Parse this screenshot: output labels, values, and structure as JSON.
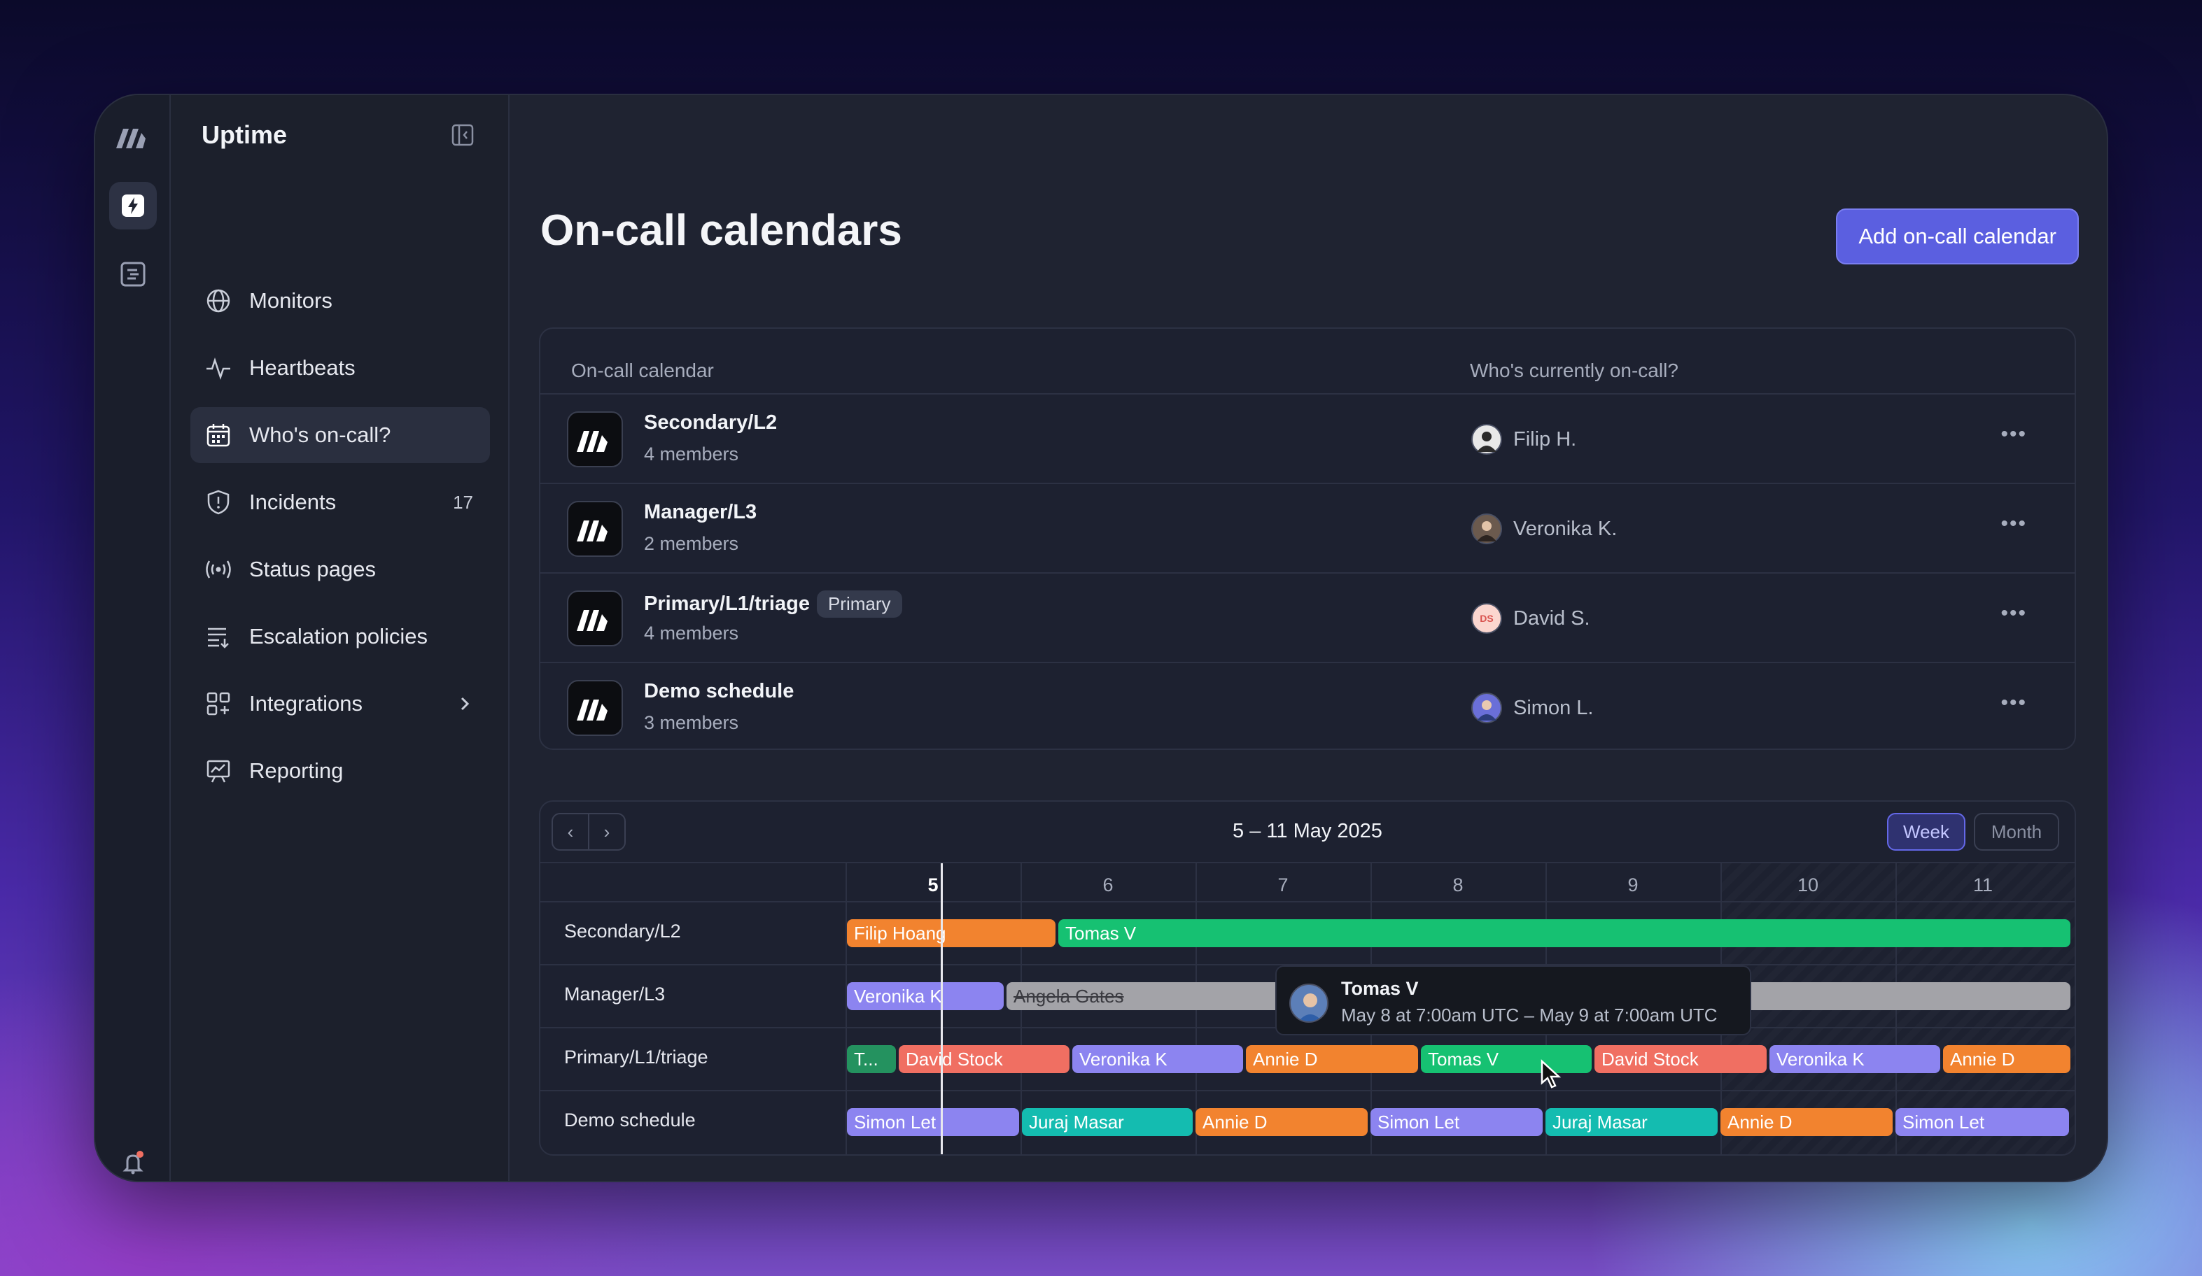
{
  "app": {
    "title": "Uptime"
  },
  "sidebar": {
    "items": [
      {
        "label": "Monitors",
        "icon": "globe-icon"
      },
      {
        "label": "Heartbeats",
        "icon": "pulse-icon"
      },
      {
        "label": "Who's on-call?",
        "icon": "calendar-icon",
        "active": true
      },
      {
        "label": "Incidents",
        "icon": "shield-icon",
        "count": "17"
      },
      {
        "label": "Status pages",
        "icon": "broadcast-icon"
      },
      {
        "label": "Escalation policies",
        "icon": "list-icon"
      },
      {
        "label": "Integrations",
        "icon": "grid-icon"
      },
      {
        "label": "Reporting",
        "icon": "chart-icon"
      }
    ]
  },
  "page": {
    "title": "On-call calendars",
    "add_button": "Add on-call calendar"
  },
  "table": {
    "col_calendar": "On-call calendar",
    "col_oncall": "Who's currently on-call?",
    "rows": [
      {
        "name": "Secondary/L2",
        "members": "4 members",
        "badge": "",
        "oncall": "Filip H."
      },
      {
        "name": "Manager/L3",
        "members": "2 members",
        "badge": "",
        "oncall": "Veronika K."
      },
      {
        "name": "Primary/L1/triage",
        "members": "4 members",
        "badge": "Primary",
        "oncall": "David S.",
        "oncall_initials": "DS"
      },
      {
        "name": "Demo schedule",
        "members": "3 members",
        "badge": "",
        "oncall": "Simon L."
      }
    ]
  },
  "calendar": {
    "range": "5 – 11 May 2025",
    "view_week": "Week",
    "view_month": "Month",
    "days": [
      "5",
      "6",
      "7",
      "8",
      "9",
      "10",
      "11"
    ],
    "lanes": [
      {
        "label": "Secondary/L2",
        "shifts": [
          "Filip Hoang",
          "Tomas V"
        ]
      },
      {
        "label": "Manager/L3",
        "shifts": [
          "Veronika K",
          "Angela Gates",
          ""
        ]
      },
      {
        "label": "Primary/L1/triage",
        "shifts": [
          "T...",
          "David Stock",
          "Veronika K",
          "Annie D",
          "Tomas V",
          "David Stock",
          "Veronika K",
          "Annie D"
        ]
      },
      {
        "label": "Demo schedule",
        "shifts": [
          "Simon Let",
          "Juraj Masar",
          "Annie D",
          "Simon Let",
          "Juraj Masar",
          "Annie D",
          "Simon Let"
        ]
      }
    ],
    "tooltip": {
      "name": "Tomas V",
      "time": "May 8 at 7:00am UTC – May 9 at 7:00am UTC"
    }
  },
  "colors": {
    "accent": "#5b5fe0",
    "orange": "#f2832f",
    "green": "#16c172",
    "purple": "#8c84f0",
    "red": "#f06f62",
    "teal": "#14bcb0",
    "gray": "#a3a3a8"
  }
}
